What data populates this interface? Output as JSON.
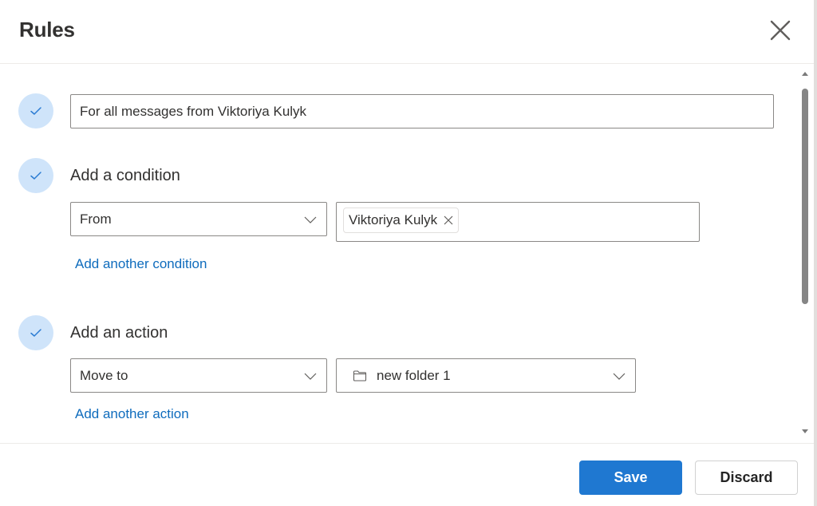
{
  "dialog": {
    "title": "Rules",
    "close_icon": "close-icon"
  },
  "rule": {
    "name_value": "For all messages from Viktoriya Kulyk"
  },
  "condition": {
    "heading": "Add a condition",
    "type_value": "From",
    "recipients": [
      {
        "name": "Viktoriya Kulyk"
      }
    ],
    "add_another": "Add another condition"
  },
  "action": {
    "heading": "Add an action",
    "type_value": "Move to",
    "folder_value": "new folder 1",
    "folder_icon": "folder-icon",
    "add_another": "Add another action"
  },
  "footer": {
    "save_label": "Save",
    "discard_label": "Discard"
  },
  "colors": {
    "accent": "#1f78d1",
    "link": "#0f6cbd",
    "check_bg": "#cfe4fa"
  }
}
